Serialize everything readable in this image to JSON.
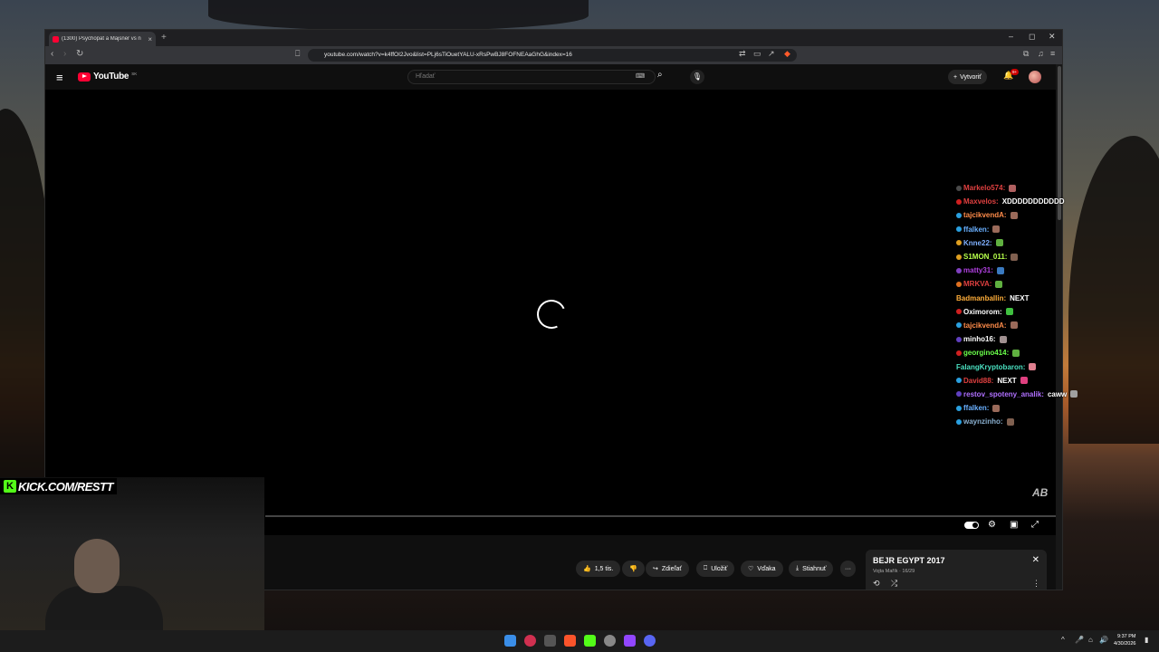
{
  "browser": {
    "tab_title": "(1300) Psychopat a Majsner vs n",
    "url": "youtube.com/watch?v=k4ffOI2Jvo&list=PLj6sTiOuetYALU-xRsPwBJ8FOFNEAaGhG&index=16",
    "new_tab_icon": "+",
    "controls": {
      "minimize": "–",
      "maximize": "◻",
      "close": "✕"
    }
  },
  "youtube": {
    "logo_text": "YouTube",
    "logo_sup": "SK",
    "search_placeholder": "Hľadať",
    "create_label": "Vytvoriť",
    "notif_badge": "9+"
  },
  "player": {
    "watermark": "AB"
  },
  "actions": {
    "likes": "1,5 tis.",
    "share": "Zdieľať",
    "save": "Uložiť",
    "thanks": "Vďaka",
    "download": "Stiahnuť",
    "more": "···"
  },
  "playlist": {
    "title": "BEJR EGYPT 2017",
    "subtitle": "Vojta Mařík · 16/29"
  },
  "chat": [
    {
      "user": "Markelo574:",
      "color": "#e04040",
      "badge": "#4a4a4a",
      "text": "",
      "emote": "#b06060"
    },
    {
      "user": "Maxvelos:",
      "color": "#e04040",
      "badge": "#d02020",
      "text": "XDDDDDDDDDDD",
      "emote": ""
    },
    {
      "user": "tajcikvendA:",
      "color": "#ff8c4a",
      "badge": "#2aa0e0",
      "text": "",
      "emote": "#9a6a5a"
    },
    {
      "user": "ffalken:",
      "color": "#6ab0ff",
      "badge": "#2aa0e0",
      "text": "",
      "emote": "#9a6a5a"
    },
    {
      "user": "Knne22:",
      "color": "#7fb0ff",
      "badge": "#e0a020",
      "text": "",
      "emote": "#60b040"
    },
    {
      "user": "S1MON_011:",
      "color": "#b6ff4a",
      "badge": "#e0a020",
      "text": "",
      "emote": "#806050"
    },
    {
      "user": "matty31:",
      "color": "#b040e0",
      "badge": "#8040c0",
      "text": "",
      "emote": "#3a7ac0"
    },
    {
      "user": "MRKVA:",
      "color": "#e04040",
      "badge": "#e07020",
      "text": "",
      "emote": "#60b040"
    },
    {
      "user": "Badmanballin:",
      "color": "#ffae3a",
      "badge": "",
      "text": "NEXT",
      "emote": ""
    },
    {
      "user": "Oximorom:",
      "color": "#ffffff",
      "badge": "#d02020",
      "text": "",
      "emote": "#40c040"
    },
    {
      "user": "tajcikvendA:",
      "color": "#ff8c4a",
      "badge": "#2aa0e0",
      "text": "",
      "emote": "#9a6a5a"
    },
    {
      "user": "minho16:",
      "color": "#ffffff",
      "badge": "#6040c0",
      "text": "",
      "emote": "#a09090"
    },
    {
      "user": "georgino414:",
      "color": "#6aff4a",
      "badge": "#d02020",
      "text": "",
      "emote": "#60b040"
    },
    {
      "user": "FalangKryptobaron:",
      "color": "#4ae0c0",
      "badge": "",
      "text": "",
      "emote": "#e08090"
    },
    {
      "user": "David88:",
      "color": "#e04040",
      "badge": "#2aa0e0",
      "text": "NEXT",
      "emote": "#e04080"
    },
    {
      "user": "restov_spoteny_analik:",
      "color": "#b070ff",
      "badge": "#6040c0",
      "text": "caww",
      "emote": "#a0a0a0"
    },
    {
      "user": "ffalken:",
      "color": "#6ab0ff",
      "badge": "#2aa0e0",
      "text": "",
      "emote": "#9a6a5a"
    },
    {
      "user": "waynzinho:",
      "color": "#8ab0d0",
      "badge": "#2aa0e0",
      "text": "",
      "emote": "#806050"
    }
  ],
  "stream": {
    "overlay_text": "KICK.COM/RESTT"
  },
  "taskbar": {
    "time": "9:37 PM",
    "date": "4/30/2026"
  },
  "colors": {
    "youtube_red": "#ff0033",
    "kick_green": "#53fc18"
  }
}
